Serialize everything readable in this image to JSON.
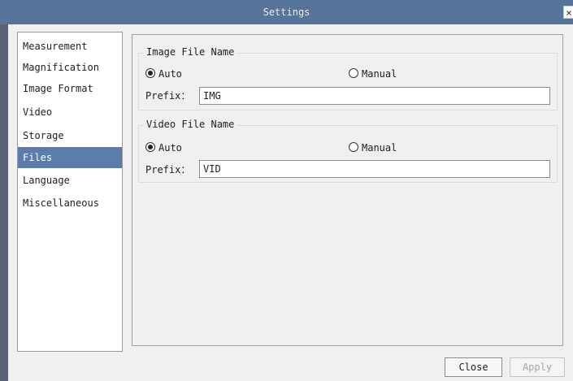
{
  "window": {
    "title": "Settings",
    "close_glyph": "×"
  },
  "sidebar": {
    "selected_index": 5,
    "items": [
      {
        "label": "Measurement"
      },
      {
        "label": "Magnification"
      },
      {
        "label": "Image Format"
      },
      {
        "label": "Video"
      },
      {
        "label": "Storage"
      },
      {
        "label": "Files"
      },
      {
        "label": "Language"
      },
      {
        "label": "Miscellaneous"
      }
    ]
  },
  "image_file_name": {
    "title": "Image File Name",
    "auto_label": "Auto",
    "manual_label": "Manual",
    "selected": "Auto",
    "prefix_label": "Prefix：",
    "prefix_value": "IMG"
  },
  "video_file_name": {
    "title": "Video File Name",
    "auto_label": "Auto",
    "manual_label": "Manual",
    "selected": "Auto",
    "prefix_label": "Prefix：",
    "prefix_value": "VID"
  },
  "buttons": {
    "close": "Close",
    "apply": "Apply",
    "apply_enabled": false
  },
  "colors": {
    "titlebar": "#56739a",
    "selection": "#5c7dab"
  }
}
